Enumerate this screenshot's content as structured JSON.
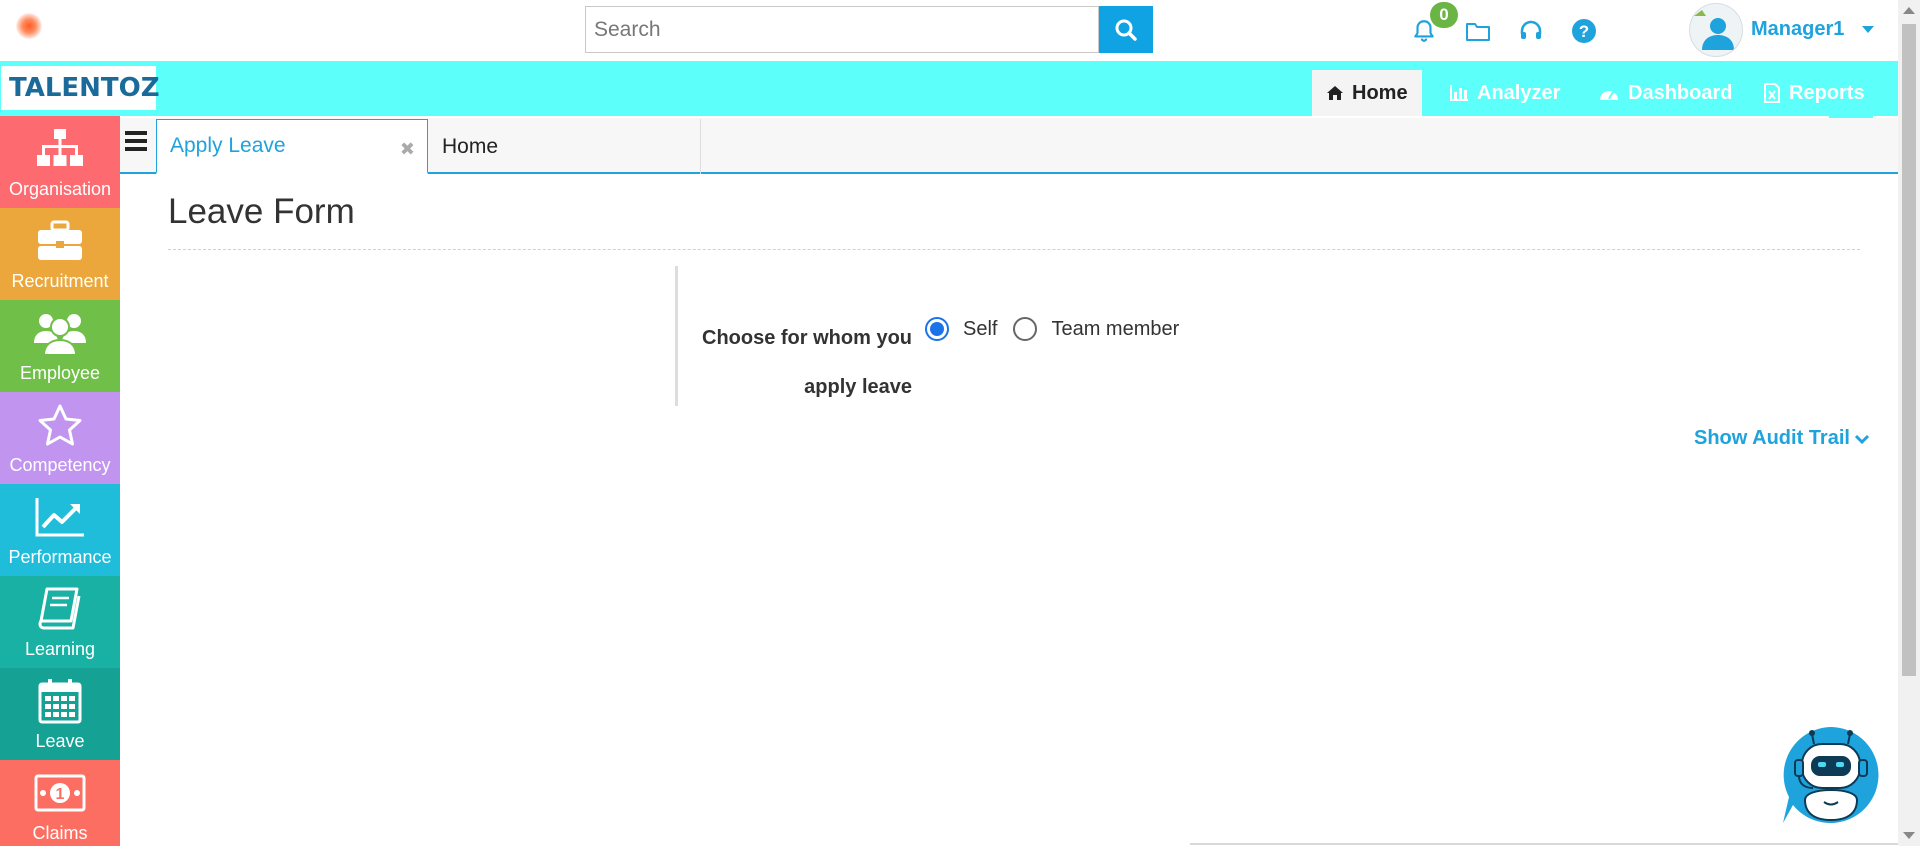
{
  "search": {
    "placeholder": "Search"
  },
  "notifications": {
    "count": "0"
  },
  "user": {
    "name": "Manager1"
  },
  "brand": {
    "name": "TALENTOZ"
  },
  "nav": [
    {
      "label": "Home",
      "icon": "home-icon",
      "active": true
    },
    {
      "label": "Analyzer",
      "icon": "bar-chart-icon"
    },
    {
      "label": "Dashboard",
      "icon": "dashboard-icon"
    },
    {
      "label": "Reports",
      "icon": "excel-file-icon"
    }
  ],
  "sidebar": {
    "items": [
      {
        "label": "Organisation",
        "icon": "org-chart-icon",
        "color": "#fd6b71"
      },
      {
        "label": "Recruitment",
        "icon": "briefcase-icon",
        "color": "#eba73b"
      },
      {
        "label": "Employee",
        "icon": "users-icon",
        "color": "#6fbf48"
      },
      {
        "label": "Competency",
        "icon": "star-icon",
        "color": "#c194f0"
      },
      {
        "label": "Performance",
        "icon": "trend-chart-icon",
        "color": "#1fbdd9"
      },
      {
        "label": "Learning",
        "icon": "book-icon",
        "color": "#19b1a3"
      },
      {
        "label": "Leave",
        "icon": "calendar-icon",
        "color": "#16a195"
      },
      {
        "label": "Claims",
        "icon": "money-icon",
        "color": "#fd6e62"
      }
    ]
  },
  "tabs": [
    {
      "label": "Apply Leave",
      "active": true
    },
    {
      "label": "Home"
    }
  ],
  "page": {
    "title": "Leave Form",
    "question": "Choose for whom you apply leave",
    "options": [
      {
        "label": "Self",
        "checked": true
      },
      {
        "label": "Team member",
        "checked": false
      }
    ],
    "audit_link": "Show Audit Trail"
  },
  "colors": {
    "accent": "#1ea3dc",
    "navbar": "#5dfffb",
    "search_button": "#0fa3e3",
    "badge": "#6bb544"
  }
}
